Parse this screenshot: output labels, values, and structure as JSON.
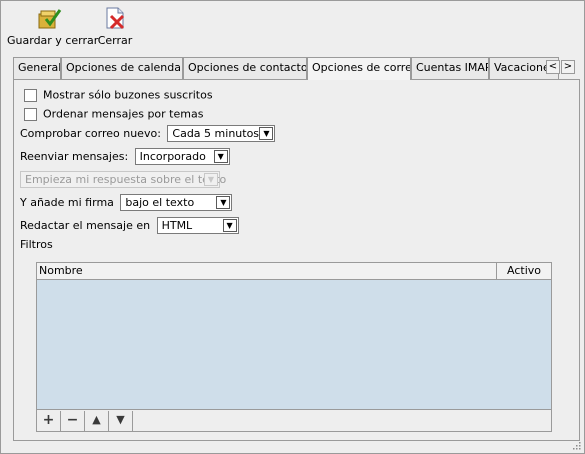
{
  "toolbar": {
    "save_label": "Guardar y cerrar",
    "close_label": "Cerrar"
  },
  "tabs": [
    {
      "label": "General"
    },
    {
      "label": "Opciones de calendario"
    },
    {
      "label": "Opciones de contactos"
    },
    {
      "label": "Opciones de correo",
      "active": true
    },
    {
      "label": "Cuentas IMAP"
    },
    {
      "label": "Vacaciones"
    }
  ],
  "tab_scroll": {
    "left": "<",
    "right": ">"
  },
  "form": {
    "show_subscribed": {
      "label": "Mostrar sólo buzones suscritos",
      "checked": false
    },
    "thread_messages": {
      "label": "Ordenar mensajes por temas",
      "checked": false
    },
    "check_mail": {
      "label": "Comprobar correo nuevo:",
      "value": "Cada 5 minutos"
    },
    "forward": {
      "label": "Reenviar mensajes:",
      "value": "Incorporado"
    },
    "reply_position": {
      "value": "Empieza mi respuesta sobre el texto",
      "disabled": true
    },
    "signature": {
      "label": "Y añade mi firma",
      "value": "bajo el texto"
    },
    "compose_format": {
      "label": "Redactar el mensaje en",
      "value": "HTML"
    },
    "filters_label": "Filtros"
  },
  "filters_table": {
    "columns": [
      "Nombre",
      "Activo"
    ],
    "rows": []
  },
  "filter_tools": {
    "add": "+",
    "remove": "−",
    "up": "▲",
    "down": "▼"
  },
  "colors": {
    "table_bg": "#cfdeea",
    "window_bg": "#eeeeee"
  }
}
